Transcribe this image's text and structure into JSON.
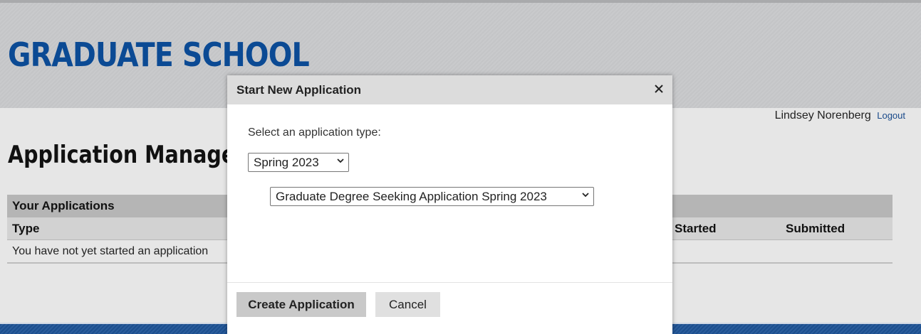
{
  "header": {
    "site_title": "GRADUATE SCHOOL"
  },
  "user": {
    "name": "Lindsey Norenberg",
    "logout_label": "Logout"
  },
  "page": {
    "heading": "Application Manageme"
  },
  "applications": {
    "caption": "Your Applications",
    "columns": {
      "type": "Type",
      "started": "Started",
      "submitted": "Submitted"
    },
    "empty_message": "You have not yet started an application"
  },
  "modal": {
    "title": "Start New Application",
    "close_icon": "close-icon",
    "label": "Select an application type:",
    "term_select": {
      "value": "Spring 2023"
    },
    "app_select": {
      "value": "Graduate Degree Seeking Application Spring 2023"
    },
    "create_label": "Create Application",
    "cancel_label": "Cancel"
  },
  "colors": {
    "brand_blue": "#0b4a94",
    "footer_blue": "#1c4f8e"
  }
}
